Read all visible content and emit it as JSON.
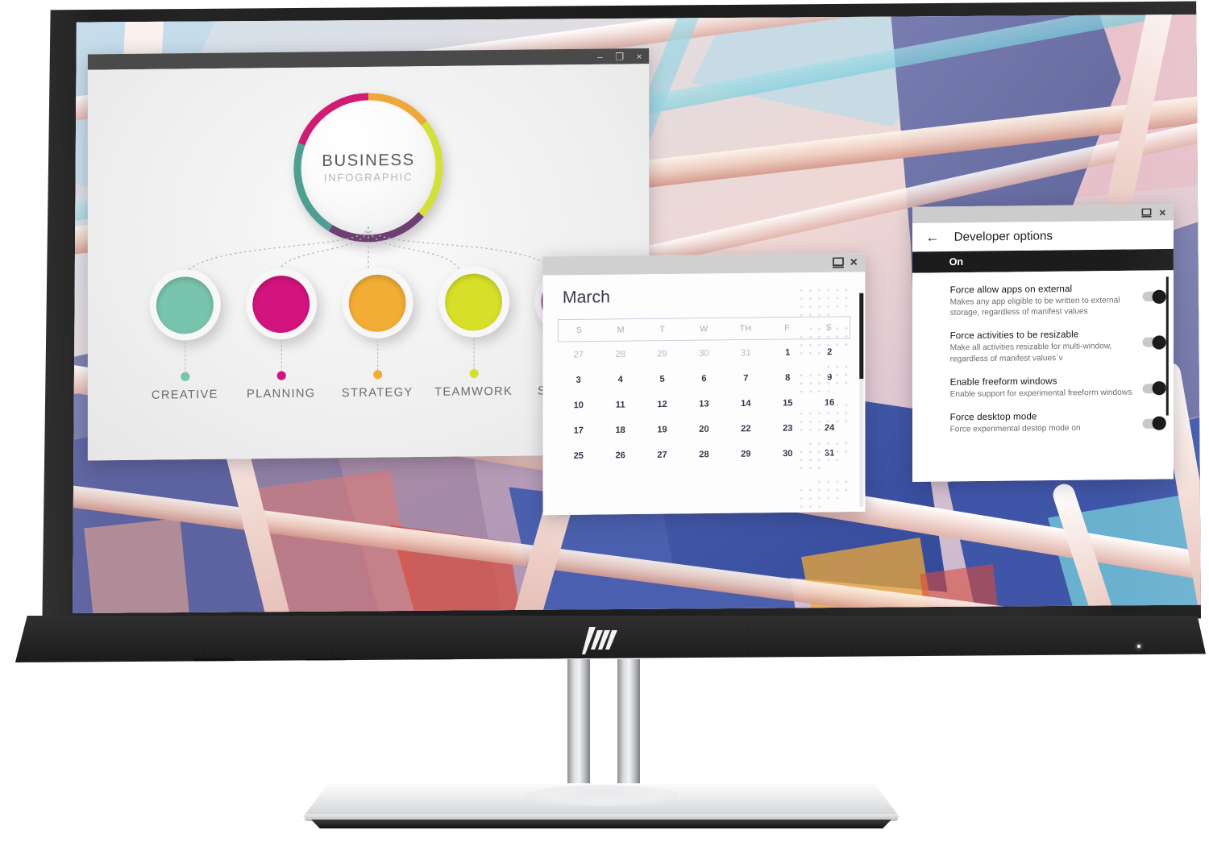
{
  "product": {
    "brand": "HP",
    "logo_name": "hp-logo",
    "bezel_color": "#1f1f1f",
    "stand_color": "#e2e3e5"
  },
  "desktop": {
    "wallpaper_name": "abstract-architecture-wallpaper",
    "wallpaper_colors": [
      "#6b72a8",
      "#3f56a8",
      "#e9b4b4",
      "#f2cfc4",
      "#9fd8e0",
      "#d94b3c",
      "#efa93a"
    ]
  },
  "windows": {
    "infographic": {
      "name": "business-infographic-window",
      "titlebar": {
        "minimize": "–",
        "maximize": "❐",
        "close": "×"
      },
      "hub": {
        "title": "BUSINESS",
        "subtitle": "INFOGRAPHIC",
        "ring_segments": [
          {
            "label": "orange",
            "color": "#f0a73a"
          },
          {
            "label": "yellow-green",
            "color": "#d2e03a"
          },
          {
            "label": "purple",
            "color": "#6e3f72"
          },
          {
            "label": "teal",
            "color": "#4f9e92"
          },
          {
            "label": "magenta",
            "color": "#ce1d72"
          }
        ]
      },
      "nodes": [
        {
          "label": "CREATIVE",
          "color": "#79c4ad"
        },
        {
          "label": "PLANNING",
          "color": "#d4147e"
        },
        {
          "label": "STRATEGY",
          "color": "#f2ad36"
        },
        {
          "label": "TEAMWORK",
          "color": "#d7e028"
        },
        {
          "label": "SUCCESS",
          "color": "#8a4a8e"
        }
      ]
    },
    "calendar": {
      "name": "calendar-window",
      "titlebar": {
        "restore": "restore-icon",
        "close": "×"
      },
      "month": "March",
      "day_headers": [
        "S",
        "M",
        "T",
        "W",
        "TH",
        "F",
        "S"
      ],
      "weeks": [
        [
          {
            "d": "27",
            "muted": true
          },
          {
            "d": "28",
            "muted": true
          },
          {
            "d": "29",
            "muted": true
          },
          {
            "d": "30",
            "muted": true
          },
          {
            "d": "31",
            "muted": true
          },
          {
            "d": "1",
            "muted": false
          },
          {
            "d": "2",
            "muted": false
          }
        ],
        [
          {
            "d": "3",
            "muted": false
          },
          {
            "d": "4",
            "muted": false
          },
          {
            "d": "5",
            "muted": false
          },
          {
            "d": "6",
            "muted": false
          },
          {
            "d": "7",
            "muted": false
          },
          {
            "d": "8",
            "muted": false
          },
          {
            "d": "9",
            "muted": false
          }
        ],
        [
          {
            "d": "10",
            "muted": false
          },
          {
            "d": "11",
            "muted": false
          },
          {
            "d": "12",
            "muted": false
          },
          {
            "d": "13",
            "muted": false
          },
          {
            "d": "14",
            "muted": false
          },
          {
            "d": "15",
            "muted": false
          },
          {
            "d": "16",
            "muted": false
          }
        ],
        [
          {
            "d": "17",
            "muted": false
          },
          {
            "d": "18",
            "muted": false
          },
          {
            "d": "19",
            "muted": false
          },
          {
            "d": "20",
            "muted": false
          },
          {
            "d": "22",
            "muted": false
          },
          {
            "d": "23",
            "muted": false
          },
          {
            "d": "24",
            "muted": false
          }
        ],
        [
          {
            "d": "25",
            "muted": false
          },
          {
            "d": "26",
            "muted": false
          },
          {
            "d": "27",
            "muted": false
          },
          {
            "d": "28",
            "muted": false
          },
          {
            "d": "29",
            "muted": false
          },
          {
            "d": "30",
            "muted": false
          },
          {
            "d": "31",
            "muted": false
          }
        ]
      ]
    },
    "developer_options": {
      "name": "developer-options-window",
      "titlebar": {
        "restore": "restore-icon",
        "close": "×"
      },
      "back_icon": "←",
      "title": "Developer options",
      "master_state": "On",
      "items": [
        {
          "title": "Force allow apps on external",
          "description": "Makes any app eligible to be written to external storage, regardless of manifest values",
          "toggle": "on"
        },
        {
          "title": "Force activities to be resizable",
          "description": "Make all activities resizable for multi-window, regardless of manifest values`v",
          "toggle": "on"
        },
        {
          "title": "Enable freeform windows",
          "description": "Enable support for experimental freeform windows.",
          "toggle": "on"
        },
        {
          "title": "Force desktop mode",
          "description": "Force experimental destop mode on",
          "toggle": "on"
        }
      ]
    }
  }
}
